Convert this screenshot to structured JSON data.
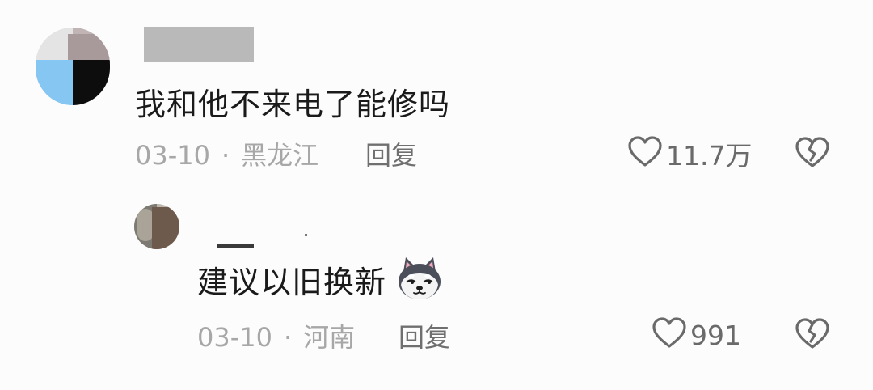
{
  "comment": {
    "text": "我和他不来电了能修吗",
    "date": "03-10",
    "separator": "·",
    "location": "黑龙江",
    "reply_label": "回复",
    "likes": "11.7万"
  },
  "reply": {
    "text": "建议以旧换新",
    "date": "03-10",
    "separator": "·",
    "location": "河南",
    "reply_label": "回复",
    "likes": "991",
    "emoji": "dog-emoji"
  },
  "colors": {
    "text": "#1a1a1a",
    "meta": "#a7a7a7",
    "action": "#6f6f6f",
    "background": "#fcfcfc"
  }
}
